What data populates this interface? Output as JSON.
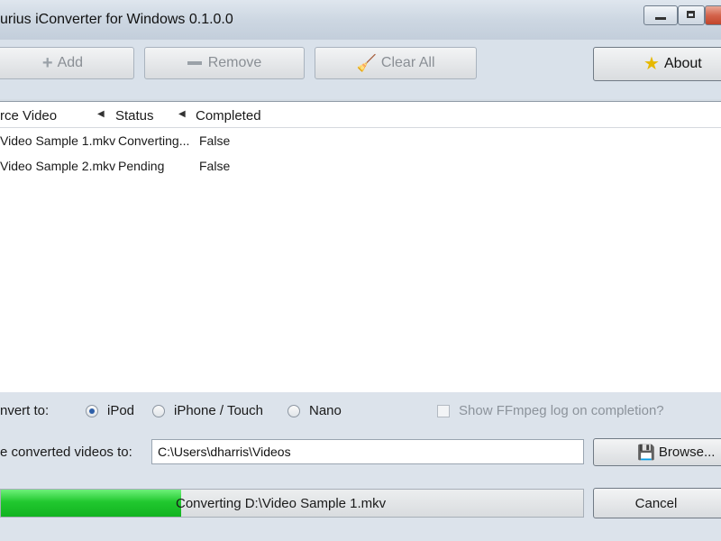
{
  "window": {
    "title": "urius iConverter for Windows 0.1.0.0"
  },
  "toolbar": {
    "add_label": "Add",
    "remove_label": "Remove",
    "clear_label": "Clear All",
    "about_label": "About",
    "add_icon": "plus-icon",
    "remove_icon": "minus-icon",
    "clear_icon": "broom-icon",
    "about_icon": "star-icon"
  },
  "list": {
    "columns": [
      "rce Video",
      "Status",
      "Completed"
    ],
    "rows": [
      {
        "video": "Video Sample 1.mkv",
        "status": "Converting...",
        "completed": "False"
      },
      {
        "video": "Video Sample 2.mkv",
        "status": "Pending",
        "completed": "False"
      }
    ]
  },
  "convert": {
    "label": "nvert to:",
    "options": [
      "iPod",
      "iPhone / Touch",
      "Nano"
    ],
    "selected": "iPod",
    "ffmpeg_log_label": "Show FFmpeg log on completion?",
    "ffmpeg_log_checked": false
  },
  "save": {
    "label": "e converted videos to:",
    "path": "C:\\Users\\dharris\\Videos",
    "browse_label": "Browse..."
  },
  "progress": {
    "fraction": 0.31,
    "text": "Converting D:\\Video Sample 1.mkv",
    "color": "#21c82f"
  },
  "cancel_label": "Cancel"
}
